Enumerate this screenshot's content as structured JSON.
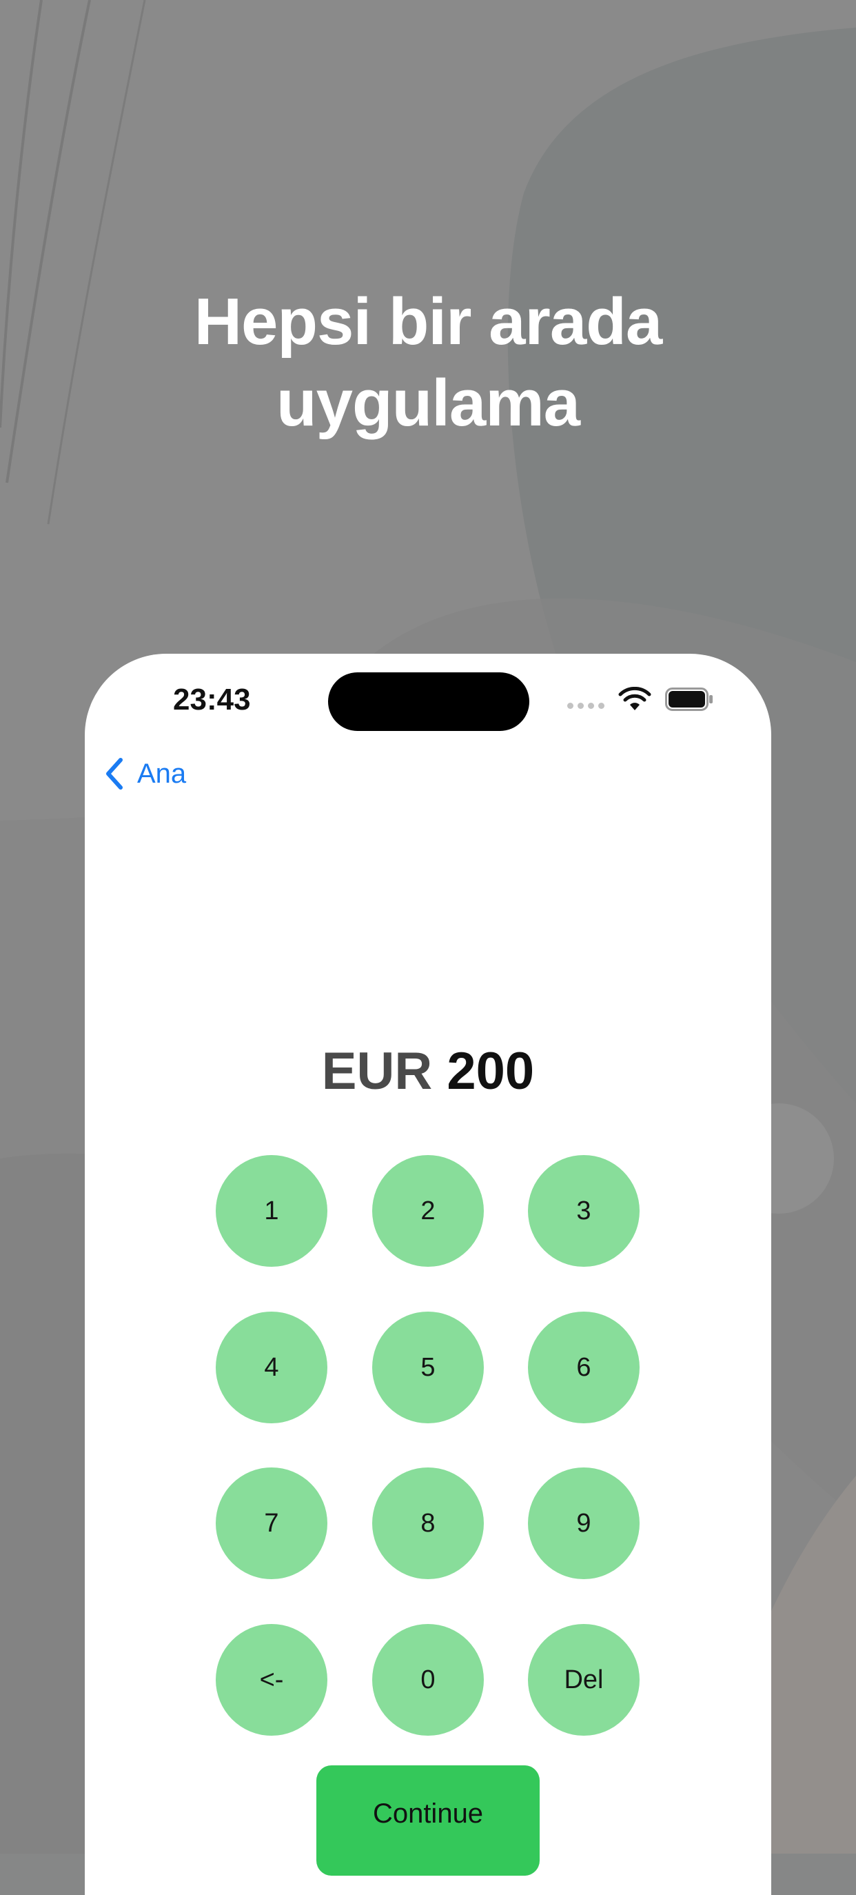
{
  "promo": {
    "headline_line1": "Hepsi bir arada",
    "headline_line2": "uygulama"
  },
  "status_bar": {
    "time": "23:43",
    "icons": [
      "signal-dots-icon",
      "wifi-icon",
      "battery-icon"
    ]
  },
  "nav": {
    "back_label": "Ana",
    "back_icon": "chevron-left-icon"
  },
  "amount": {
    "currency": "EUR",
    "value": "200"
  },
  "keypad": {
    "keys": [
      "1",
      "2",
      "3",
      "4",
      "5",
      "6",
      "7",
      "8",
      "9",
      "<-",
      "0",
      "Del"
    ]
  },
  "actions": {
    "continue_label": "Continue"
  },
  "colors": {
    "accent_blue": "#1a7bf2",
    "key_green": "#88dd9a",
    "button_green": "#34c85a",
    "background_gray": "#868787"
  }
}
